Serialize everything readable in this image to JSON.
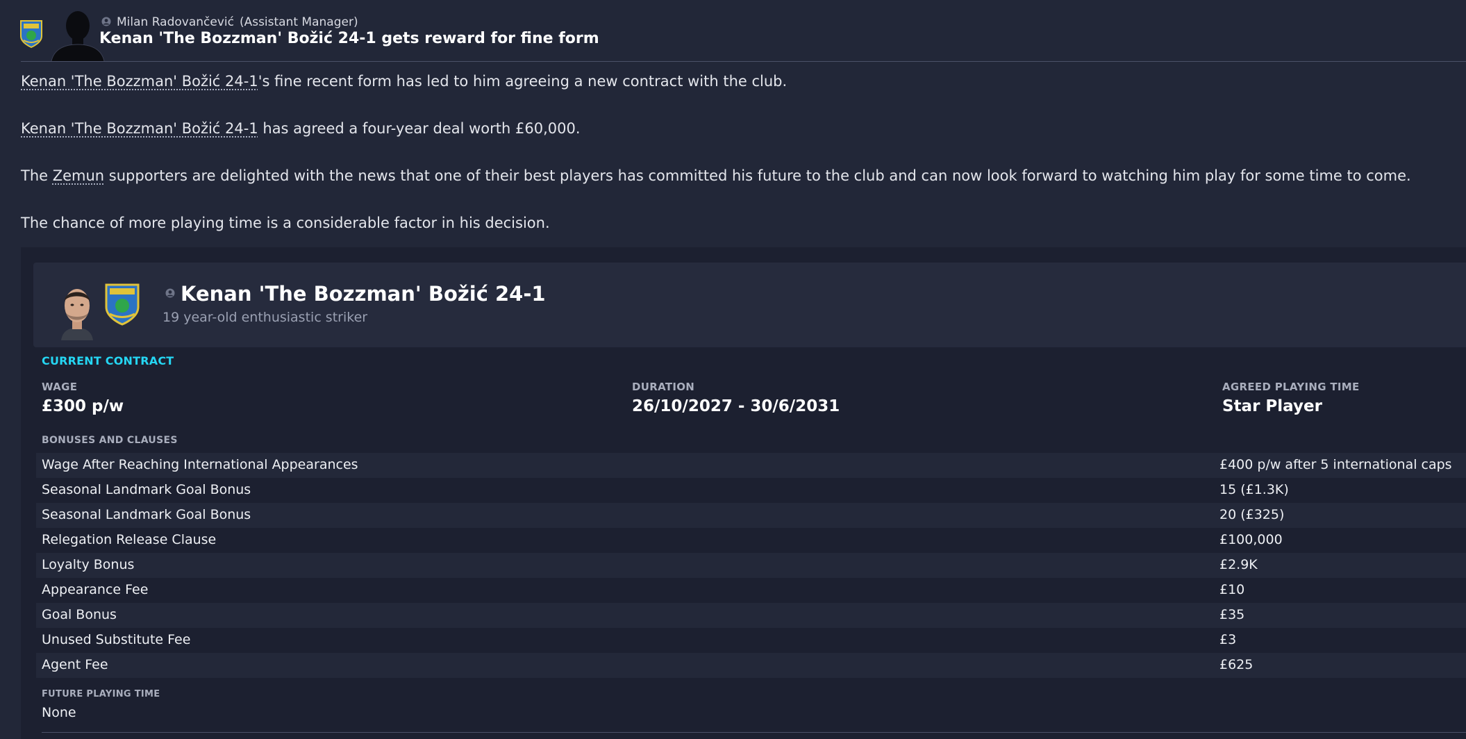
{
  "message": {
    "sender_name": "Milan Radovančević",
    "sender_role": "(Assistant Manager)",
    "headline": "Kenan 'The Bozzman' Božić 24-1 gets reward for fine form"
  },
  "body": {
    "p1_link": "Kenan 'The Bozzman' Božić 24-1",
    "p1_text": "'s fine recent form has led to him agreeing a new contract with the club.",
    "p2_link": "Kenan 'The Bozzman' Božić 24-1",
    "p2_text": " has agreed a four-year deal worth £60,000.",
    "p3_prefix": "The ",
    "p3_link": "Zemun",
    "p3_text": " supporters are delighted with the news that one of their best players has committed his future to the club and can now look forward to watching him play for some time to come.",
    "p4_text": "The chance of more playing time is a considerable factor in his decision."
  },
  "player": {
    "name": "Kenan 'The Bozzman' Božić 24-1",
    "description": "19 year-old enthusiastic striker"
  },
  "contract": {
    "section_title": "CURRENT CONTRACT",
    "wage_label": "WAGE",
    "wage_value": "£300 p/w",
    "duration_label": "DURATION",
    "duration_value": "26/10/2027 - 30/6/2031",
    "playing_time_label": "AGREED PLAYING TIME",
    "playing_time_value": "Star Player",
    "bonuses_label": "BONUSES AND CLAUSES",
    "bonuses": [
      {
        "name": "Wage After Reaching International Appearances",
        "value": "£400 p/w after 5 international caps"
      },
      {
        "name": "Seasonal Landmark Goal Bonus",
        "value": "15 (£1.3K)"
      },
      {
        "name": "Seasonal Landmark Goal Bonus",
        "value": "20 (£325)"
      },
      {
        "name": "Relegation Release Clause",
        "value": "£100,000"
      },
      {
        "name": "Loyalty Bonus",
        "value": "£2.9K"
      },
      {
        "name": "Appearance Fee",
        "value": "£10"
      },
      {
        "name": "Goal Bonus",
        "value": "£35"
      },
      {
        "name": "Unused Substitute Fee",
        "value": "£3"
      },
      {
        "name": "Agent Fee",
        "value": "£625"
      }
    ],
    "future_label": "FUTURE PLAYING TIME",
    "future_value": "None"
  },
  "colors": {
    "background": "#222738",
    "panel": "#1c2030",
    "card": "#262b3d",
    "accent": "#25d6f3"
  }
}
